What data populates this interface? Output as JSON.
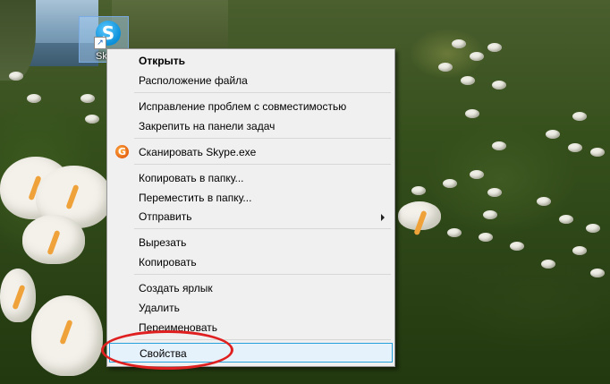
{
  "desktop": {
    "icon": {
      "name": "skype-icon",
      "label": "Sk",
      "glyph": "S",
      "arrow": "↗"
    }
  },
  "context_menu": {
    "items": [
      {
        "label": "Открыть",
        "bold": true
      },
      {
        "label": "Расположение файла"
      },
      {
        "label": "Исправление проблем с совместимостью"
      },
      {
        "label": "Закрепить на панели задач"
      },
      {
        "label": "Сканировать Skype.exe",
        "icon": "antivirus-scan-icon"
      },
      {
        "label": "Копировать в папку..."
      },
      {
        "label": "Переместить в папку..."
      },
      {
        "label": "Отправить",
        "submenu": true
      },
      {
        "label": "Вырезать"
      },
      {
        "label": "Копировать"
      },
      {
        "label": "Создать ярлык"
      },
      {
        "label": "Удалить"
      },
      {
        "label": "Переименовать"
      },
      {
        "label": "Свойства",
        "highlighted": true
      }
    ]
  },
  "colors": {
    "menu_bg": "#f0f0f0",
    "hover_bg": "#e5f1fb",
    "hover_border": "#26a0da",
    "annotation_red": "#e02020"
  }
}
